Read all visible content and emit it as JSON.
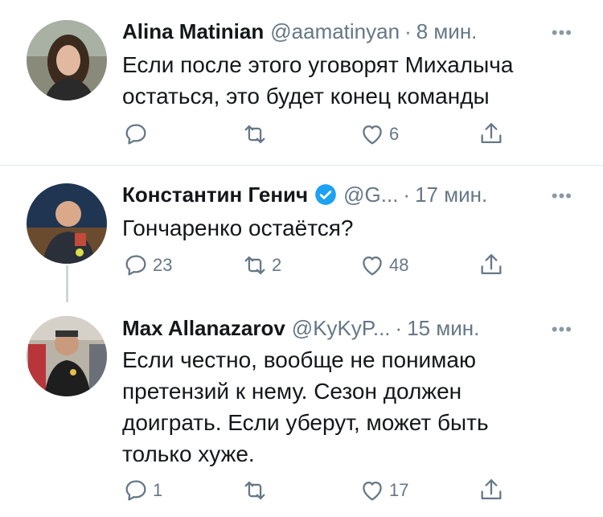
{
  "tweets": [
    {
      "name": "Alina Matinian",
      "handle": "@aamatinyan",
      "time": "8 мин.",
      "text": "Если после этого уговорят Михалыча остаться, это будет конец команды",
      "reply_count": "",
      "retweet_count": "",
      "like_count": "6"
    },
    {
      "name": "Константин Генич",
      "handle": "@G...",
      "time": "17 мин.",
      "text": "Гончаренко остаётся?",
      "reply_count": "23",
      "retweet_count": "2",
      "like_count": "48"
    },
    {
      "name": "Max Allanazarov",
      "handle": "@KyKyP...",
      "time": "15 мин.",
      "text": "Если честно, вообще не понимаю претензий к нему. Сезон должен доиграть. Если уберут, может быть только хуже.",
      "reply_count": "1",
      "retweet_count": "",
      "like_count": "17"
    }
  ],
  "more_glyph": "•••",
  "dot": "·",
  "colors": {
    "secondary": "#657786",
    "verified": "#1da1f2",
    "divider": "#e1e8ed"
  }
}
